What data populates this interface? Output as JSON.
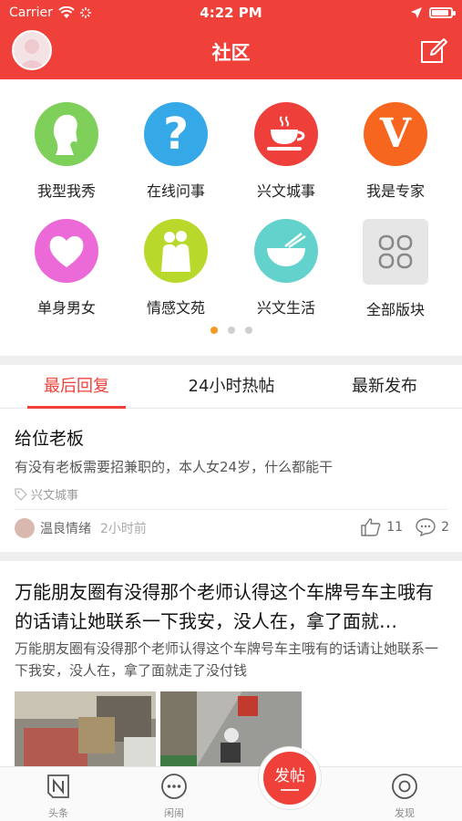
{
  "status_bar": {
    "carrier": "Carrier",
    "time": "4:22 PM"
  },
  "nav": {
    "title": "社区",
    "edit_icon": "edit-icon",
    "avatar": "avatar"
  },
  "categories": [
    {
      "label": "我型我秀",
      "icon": "woman-silhouette-icon",
      "color": "#7ed05a"
    },
    {
      "label": "在线问事",
      "icon": "question-icon",
      "color": "#35a8e8"
    },
    {
      "label": "兴文城事",
      "icon": "teacup-icon",
      "color": "#ef3f3a"
    },
    {
      "label": "我是专家",
      "icon": "letter-v-icon",
      "color": "#f6661f"
    },
    {
      "label": "单身男女",
      "icon": "heart-icon",
      "color": "#ec6ad7"
    },
    {
      "label": "情感文苑",
      "icon": "couple-icon",
      "color": "#b8d92c"
    },
    {
      "label": "兴文生活",
      "icon": "noodle-bowl-icon",
      "color": "#63d2cc"
    },
    {
      "label": "全部版块",
      "icon": "grid-icon",
      "color": "#e6e6e6"
    }
  ],
  "pager": {
    "pages": 3,
    "active": 0
  },
  "tabs": [
    {
      "label": "最后回复",
      "active": true
    },
    {
      "label": "24小时热帖",
      "active": false
    },
    {
      "label": "最新发布",
      "active": false
    }
  ],
  "posts": [
    {
      "title": "给位老板",
      "summary": "有没有老板需要招兼职的，本人女24岁，什么都能干",
      "tag": "兴文城事",
      "author": "温良情绪",
      "time_ago": "2小时前",
      "likes": "11",
      "comments": "2"
    },
    {
      "title": "万能朋友圈有没得那个老师认得这个车牌号车主哦有的话请让她联系一下我安，没人在，拿了面就…",
      "summary": "万能朋友圈有没得那个老师认得这个车牌号车主哦有的话请让她联系一下我安，没人在，拿了面就走了没付钱"
    }
  ],
  "bottom_tabs": [
    {
      "label": "头条",
      "icon": "n-logo-icon"
    },
    {
      "label": "闲闹",
      "icon": "chat-bubble-icon"
    },
    {
      "label": "发现",
      "icon": "discover-icon"
    }
  ],
  "post_button": {
    "label": "发帖"
  }
}
